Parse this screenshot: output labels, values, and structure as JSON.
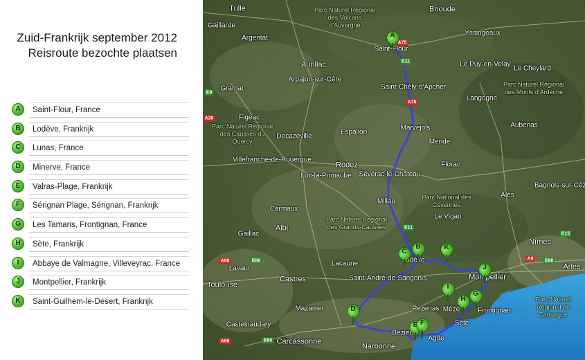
{
  "title": {
    "line1": "Zuid-Frankrijk september 2012",
    "line2": "Reisroute bezochte plaatsen"
  },
  "route_color": "#3a3fe0",
  "marker_color": "#4fb82e",
  "stops": [
    {
      "letter": "A",
      "name": "Saint-Flour, France"
    },
    {
      "letter": "B",
      "name": "Lodève, Frankrijk"
    },
    {
      "letter": "C",
      "name": "Lunas, France"
    },
    {
      "letter": "D",
      "name": "Minerve, France"
    },
    {
      "letter": "E",
      "name": "Valras-Plage, Frankrijk"
    },
    {
      "letter": "F",
      "name": "Sérignan Plage, Sérignan, Frankrijk"
    },
    {
      "letter": "G",
      "name": "Les Tamaris, Frontignan, France"
    },
    {
      "letter": "H",
      "name": "Sète, Frankrijk"
    },
    {
      "letter": "I",
      "name": "Abbaye de Valmagne, Villeveyrac, France"
    },
    {
      "letter": "J",
      "name": "Montpellier, Frankrijk"
    },
    {
      "letter": "K",
      "name": "Saint-Guilhem-le-Désert, Frankrijk"
    }
  ],
  "map": {
    "places": [
      "Tulle",
      "Brioude",
      "Argentat",
      "Aurillac",
      "Le Puy-en-Velay",
      "Yssingeaux",
      "Saint-Flour",
      "Gramat",
      "Arpajon-sur-Cère",
      "Le Cheylard",
      "Saint-Chély-d'Apcher",
      "Langogne",
      "Figeac",
      "Espalion",
      "Marvejols",
      "Mende",
      "Aubenas",
      "Decazeville",
      "Villefranche-de-Rouergue",
      "Rodez",
      "Florac",
      "Sévérac-le-Château",
      "Luc-la-Primaube",
      "Bagnols-sur-Cèze",
      "Alès",
      "Millau",
      "Carmaux",
      "Le Vigan",
      "Gaillac",
      "Albi",
      "Nîmes",
      "Lacaune",
      "Lodève",
      "Montpellier",
      "Arles",
      "Toulouse",
      "Lavaur",
      "Castres",
      "Saint-André-de-Sangonis",
      "Sète",
      "Frontignan",
      "Mèze",
      "Pezenas",
      "Agde",
      "Béziers",
      "Mazamet",
      "Castelnaudary",
      "Narbonne",
      "Carcassonne",
      "Gaillarde"
    ],
    "parks": [
      "Parc Naturel Régional des Volcans d'Auvergne",
      "Parc Naturel Régional des Monts d'Ardèche",
      "Parc Naturel Régional des Causses du Quercy",
      "Parc National des Cévennes",
      "Parc Naturel Régional des Grands-Causses",
      "Parc Naturel Régional de Camargue"
    ],
    "roads": [
      "A75",
      "A75",
      "E11",
      "E11",
      "E9",
      "A20",
      "A68",
      "E80",
      "A9",
      "E80",
      "A66",
      "E80",
      "E15"
    ]
  }
}
